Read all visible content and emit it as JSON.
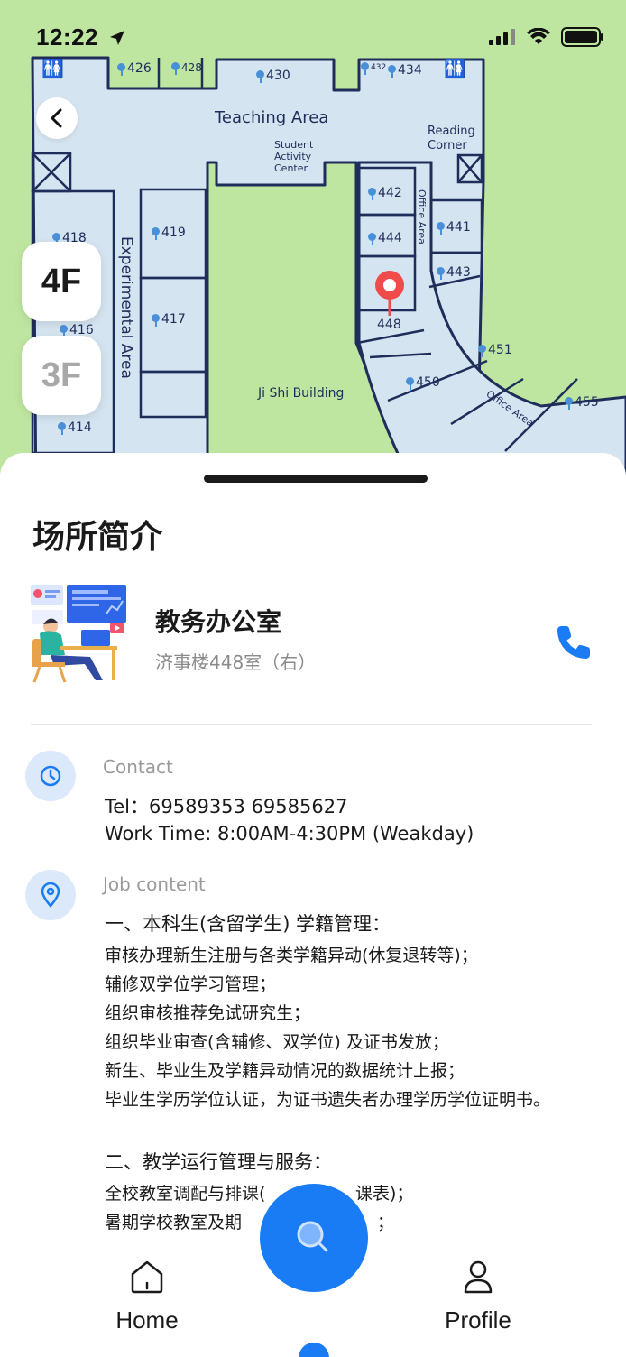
{
  "status_bar": {
    "time": "12:22"
  },
  "map": {
    "floor_buttons": [
      {
        "label": "4F",
        "active": true
      },
      {
        "label": "3F",
        "active": false
      }
    ],
    "area_labels": {
      "teaching_area": "Teaching Area",
      "student_activity_center": [
        "Student",
        "Activity",
        "Center"
      ],
      "reading_corner": [
        "Reading",
        "Corner"
      ],
      "experimental_area": "Experimental Area",
      "office_area_1": "Office Area",
      "office_area_2": "Office Area",
      "building": "Ji Shi Building"
    },
    "rooms": [
      "426",
      "428",
      "430",
      "432",
      "434",
      "442",
      "444",
      "441",
      "443",
      "418",
      "419",
      "417",
      "416",
      "414",
      "448",
      "451",
      "450",
      "455"
    ],
    "selected_room": "448"
  },
  "sheet": {
    "title": "场所简介",
    "place_name": "教务办公室",
    "place_address": "济事楼448室（右）",
    "contact": {
      "label": "Contact",
      "lines": [
        "Tel：69589353 69585627",
        "Work Time: 8:00AM-4:30PM (Weakday)"
      ]
    },
    "job": {
      "label": "Job content",
      "lines": [
        "一、本科生(含留学生) 学籍管理：",
        "审核办理新生注册与各类学籍异动(休复退转等)；",
        "辅修双学位学习管理；",
        "组织审核推荐免试研究生；",
        "组织毕业审查(含辅修、双学位) 及证书发放；",
        "新生、毕业生及学籍异动情况的数据统计上报；",
        "毕业生学历学位认证，为证书遗失者办理学历学位证明书。",
        "",
        "二、教学运行管理与服务：",
        "全校教室调配与排课(",
        "暑期学校教室及期"
      ],
      "partial_tail_1": "课表)；",
      "partial_tail_2": "；"
    }
  },
  "tabbar": {
    "home_label": "Home",
    "profile_label": "Profile"
  },
  "colors": {
    "accent": "#1a7cf5",
    "map_bg": "#bfe6a0",
    "building_fill": "#d4e4f0",
    "wall": "#1f2d5a",
    "selected_pin": "#f04a4a"
  }
}
